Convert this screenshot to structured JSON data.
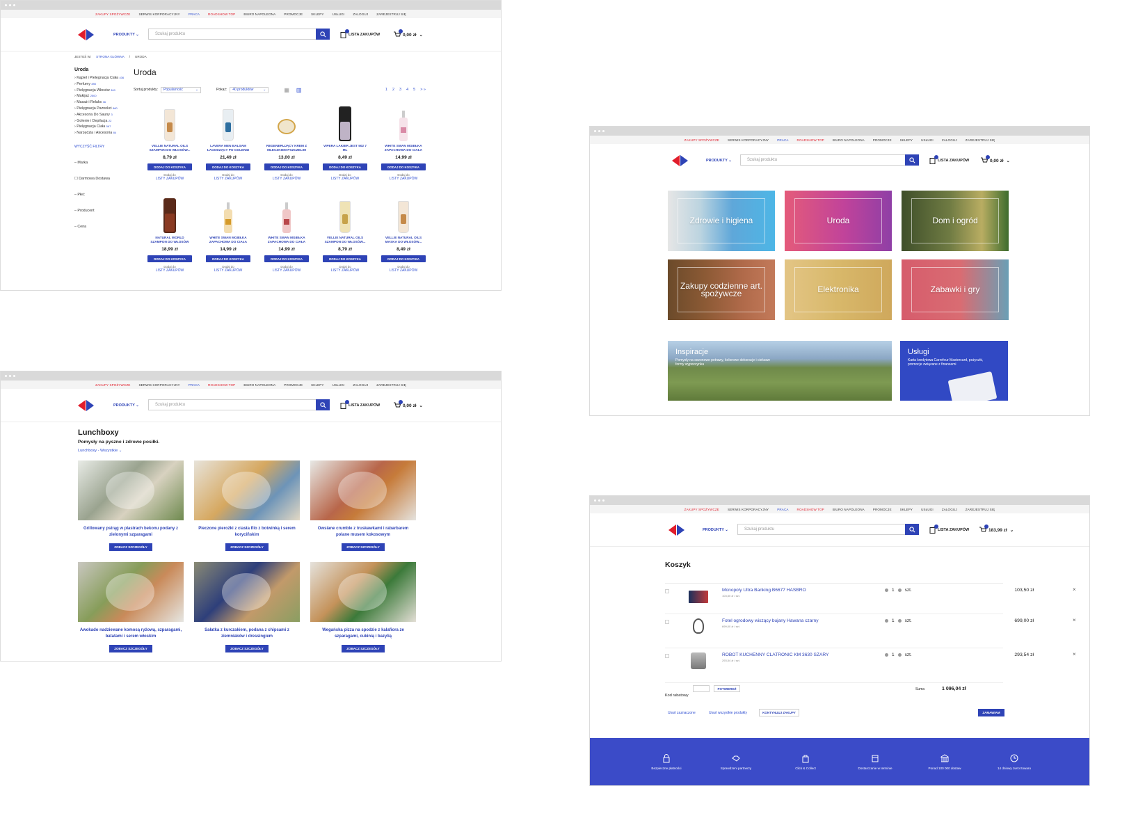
{
  "topnav": {
    "items": [
      "ZAKUPY SPOŻYWCZE",
      "SERWIS KORPORACYJNY",
      "PRACA",
      "ROADSHOW TOP",
      "BIURO NAPOLEONA",
      "PROMOCJE",
      "SKLEPY",
      "USŁUGI",
      "ZALOGUJ",
      "ZAREJESTRUJ SIĘ"
    ]
  },
  "header": {
    "products_label": "PRODUKTY",
    "search_placeholder": "Szukaj produktu",
    "shopping_list_label": "LISTA ZAKUPÓW",
    "cart_total_empty": "0,00 zł",
    "cart_total_full": "183,99 zł"
  },
  "category_page": {
    "breadcrumb": [
      "JESTEŚ W:",
      "STRONA GŁÓWNA",
      "/",
      "URODA"
    ],
    "sidebar_title": "Uroda",
    "sidebar_categories": [
      {
        "label": "Kąpiel i Pielęgnacja Ciała",
        "count": "436"
      },
      {
        "label": "Perfumy",
        "count": "890"
      },
      {
        "label": "Pielęgnacja Włosów",
        "count": "300"
      },
      {
        "label": "Makijaż",
        "count": "2500"
      },
      {
        "label": "Masaż i Relaks",
        "count": "36"
      },
      {
        "label": "Pielęgnacja Paznokci",
        "count": "860"
      },
      {
        "label": "Akcesoria Do Sauny",
        "count": "3"
      },
      {
        "label": "Golenie i Depilacja",
        "count": "22"
      },
      {
        "label": "Pielęgnacja Ciała",
        "count": "567"
      },
      {
        "label": "Narzędzia i Akcesoria",
        "count": "84"
      }
    ],
    "clear_filters": "WYCZYŚĆ FILTRY",
    "filters": [
      "Marka",
      "Darmowa Dostawa",
      "Płeć",
      "Producent",
      "Cena"
    ],
    "title": "Uroda",
    "sort_label": "Sortuj produkty:",
    "sort_value": "Popularność",
    "show_label": "Pokaż:",
    "show_value": "40 produktów",
    "pages": [
      "1",
      "2",
      "3",
      "4",
      "5",
      "> »"
    ],
    "add_to_cart": "DODAJ DO KOSZYKA",
    "add_to_list_line1": "Dodaj do",
    "add_to_list_line2": "LISTY ZAKUPÓW",
    "products": [
      {
        "name": "VELLIE NATURAL OILS SZAMPON DO WŁOSÓW...",
        "price": "8,79 zł"
      },
      {
        "name": "LAVERA MEN BALSAM ŁAGODZĄCY PO GOLENIU",
        "price": "21,49 zł"
      },
      {
        "name": "REGENERUJĄCY KREM Z MLECZKIEM PSZCZELIM",
        "price": "13,00 zł"
      },
      {
        "name": "VIPERA LAKIER JEST 502 7 ML",
        "price": "8,49 zł"
      },
      {
        "name": "WHITE SWAN MGIEŁKA ZAPACHOWA DO CIAŁA",
        "price": "14,99 zł"
      },
      {
        "name": "NATURAL WORLD SZAMPON DO WŁOSÓW",
        "price": "18,99 zł"
      },
      {
        "name": "WHITE SWAN MGIEŁKA ZAPACHOWA DO CIAŁA",
        "price": "14,99 zł"
      },
      {
        "name": "WHITE SWAN MGIEŁKA ZAPACHOWA DO CIAŁA",
        "price": "14,99 zł"
      },
      {
        "name": "VELLIE NATURAL OILS SZAMPON DO WŁOSÓW...",
        "price": "8,79 zł"
      },
      {
        "name": "VELLIE NATURAL OILS MASKA DO WŁOSÓW...",
        "price": "8,49 zł"
      }
    ]
  },
  "home_page": {
    "tiles": [
      "Zdrowie i higiena",
      "Uroda",
      "Dom i ogród",
      "Zakupy codzienne art. spożywcze",
      "Elektronika",
      "Zabawki i gry"
    ],
    "inspiration": {
      "title": "Inspiracje",
      "text": "Pomysły na sezonowe potrawy, kolorowe dekoracje i ciekawe formy wypoczynku"
    },
    "services": {
      "title": "Usługi",
      "text": "Karta kredytowa Carrefour Mastercard, pożyczki, promocje związane z finansami"
    },
    "tile_colors": [
      "#5fa7d9",
      "#c1439a",
      "#6f7b43",
      "#8c5a35",
      "#d8b86a",
      "#d96c72"
    ],
    "services_color": "#3149c4"
  },
  "lunchbox_page": {
    "title": "Lunchboxy",
    "subtitle": "Pomysły na pyszne i zdrowe posiłki.",
    "dropdown": "Lunchboxy - Wszystkie",
    "details_button": "ZOBACZ SZCZEGÓŁY",
    "recipes": [
      "Grillowany pstrąg w plastrach bekonu podany z zielonymi szparagami",
      "Pieczone pierożki z ciasta filo z botwinką i serem koryciñskim",
      "Owsiane crumble z truskawkami i rabarbarem polane musem kokosowym",
      "Awokado nadziewane komosą ryżową, szparagami, batatami i serem włoskim",
      "Sałatka z kurczakiem, podana z chipsami z ziemniaków i dressingiem",
      "Wegańska pizza na spodzie z kalafiora ze szparagami, cukinią i bazylią"
    ]
  },
  "cart_page": {
    "title": "Koszyk",
    "unit": "szt.",
    "quantity": "1",
    "items": [
      {
        "name": "Monopoly Ultra Banking B6677 HASBRO",
        "unit_price": "103,50 zł / szt.",
        "price": "103,50 zł"
      },
      {
        "name": "Fotel ogrodowy wiszący bujany Hawana czarny",
        "unit_price": "699,00 zł / szt.",
        "price": "699,00 zł"
      },
      {
        "name": "ROBOT KUCHENNY CLATRONIC KM 3630 SZARY",
        "unit_price": "293,54 zł / szt.",
        "price": "293,54 zł"
      }
    ],
    "coupon_label": "Kod rabatowy",
    "confirm_button": "POTWIERDŹ",
    "sum_label": "Suma",
    "sum_value": "1 096,04 zł",
    "remove_selected": "Usuń zaznaczone",
    "remove_all": "Usuń wszystkie produkty",
    "continue_button": "KONTYNUUJ ZAKUPY",
    "order_button": "ZAMAWIAM",
    "footer_items": [
      "Bezpieczne płatności",
      "Sprawdzeni partnerzy",
      "Click & Collect",
      "Dostarczanie w terminie",
      "Ponad 100 000 dostaw",
      "14 dniowy zwrot towaru"
    ]
  },
  "colors": {
    "brand_blue": "#2e43b6",
    "brand_red": "#e11d2b",
    "footer_blue": "#3b4bc8"
  }
}
